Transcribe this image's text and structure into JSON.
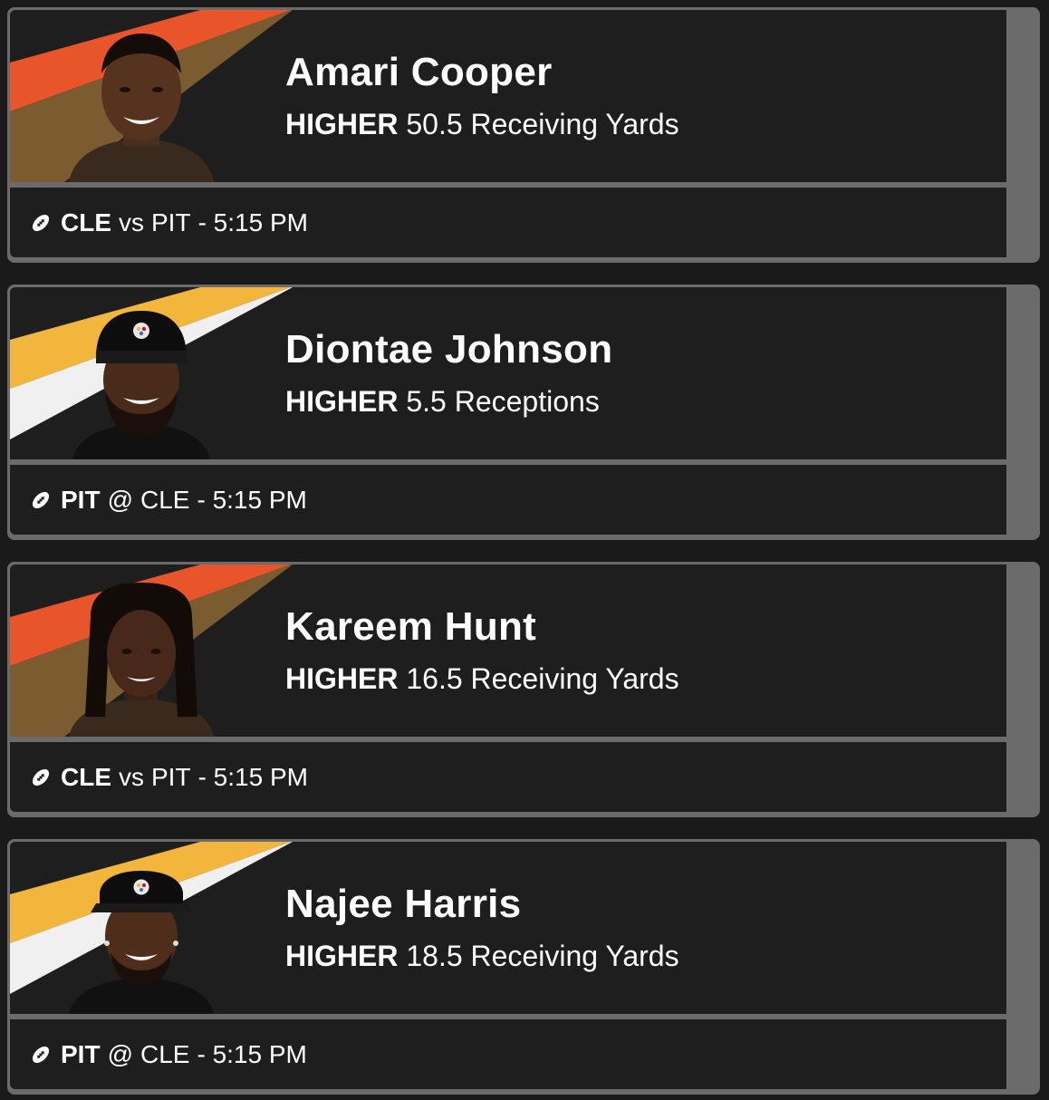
{
  "cards": [
    {
      "player_name": "Amari Cooper",
      "direction": "HIGHER",
      "line": "50.5",
      "stat": "Receiving Yards",
      "team": "CLE",
      "matchup_sep": "vs",
      "opponent": "PIT",
      "time": "- 5:15 PM",
      "stripe_colors": [
        "#e8552a",
        "#7a5c30"
      ],
      "jersey_color": "#3a2a1e",
      "headwear": "none"
    },
    {
      "player_name": "Diontae Johnson",
      "direction": "HIGHER",
      "line": "5.5",
      "stat": "Receptions",
      "team": "PIT",
      "matchup_sep": "@",
      "opponent": "CLE",
      "time": "- 5:15 PM",
      "stripe_colors": [
        "#f2b63c",
        "#f0f0f0"
      ],
      "jersey_color": "#111111",
      "headwear": "steelers-beanie"
    },
    {
      "player_name": "Kareem Hunt",
      "direction": "HIGHER",
      "line": "16.5",
      "stat": "Receiving Yards",
      "team": "CLE",
      "matchup_sep": "vs",
      "opponent": "PIT",
      "time": "- 5:15 PM",
      "stripe_colors": [
        "#e8552a",
        "#7a5c30"
      ],
      "jersey_color": "#3a2a1e",
      "headwear": "dreadlocks"
    },
    {
      "player_name": "Najee Harris",
      "direction": "HIGHER",
      "line": "18.5",
      "stat": "Receiving Yards",
      "team": "PIT",
      "matchup_sep": "@",
      "opponent": "CLE",
      "time": "- 5:15 PM",
      "stripe_colors": [
        "#f2b63c",
        "#f0f0f0"
      ],
      "jersey_color": "#111111",
      "headwear": "steelers-visor"
    }
  ],
  "icons": {
    "sport": "football-icon"
  }
}
